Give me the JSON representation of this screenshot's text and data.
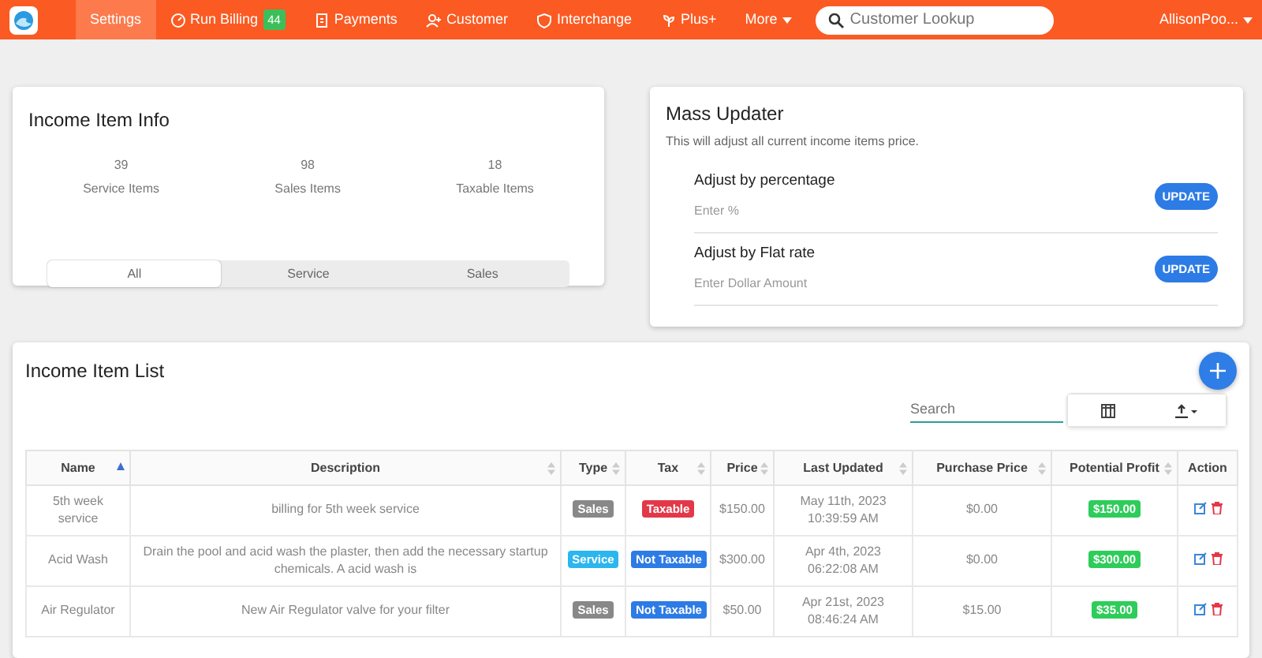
{
  "navbar": {
    "items": [
      {
        "label": "Settings",
        "selected": true
      },
      {
        "label": "Run Billing",
        "badge": "44",
        "selected": false
      },
      {
        "label": "Payments",
        "selected": false
      },
      {
        "label": "Customer",
        "selected": false
      },
      {
        "label": "Interchange",
        "selected": false
      },
      {
        "label": "Plus+",
        "selected": false
      },
      {
        "label": "More",
        "dropdown": true,
        "selected": false
      }
    ],
    "search": {
      "placeholder": "Customer Lookup"
    },
    "user": "AllisonPoo..."
  },
  "info": {
    "title": "Income Item Info",
    "stats": [
      {
        "value": "39",
        "label": "Service Items"
      },
      {
        "value": "98",
        "label": "Sales Items"
      },
      {
        "value": "18",
        "label": "Taxable Items"
      }
    ],
    "filters": [
      {
        "label": "All",
        "selected": true
      },
      {
        "label": "Service",
        "selected": false
      },
      {
        "label": "Sales",
        "selected": false
      }
    ]
  },
  "mass_updater": {
    "title": "Mass Updater",
    "subtitle": "This will adjust all current income items price.",
    "adjusters": [
      {
        "label": "Adjust by percentage",
        "placeholder": "Enter %",
        "button": "UPDATE"
      },
      {
        "label": "Adjust by Flat rate",
        "placeholder": "Enter Dollar Amount",
        "button": "UPDATE"
      }
    ]
  },
  "list": {
    "title": "Income Item List",
    "search": {
      "placeholder": "Search"
    },
    "columns": [
      {
        "label": "Name",
        "sorted": true
      },
      {
        "label": "Description",
        "sorted": false
      },
      {
        "label": "Type",
        "sorted": false
      },
      {
        "label": "Tax",
        "sorted": false
      },
      {
        "label": "Price",
        "sorted": false
      },
      {
        "label": "Last Updated",
        "sorted": false
      },
      {
        "label": "Purchase Price",
        "sorted": false
      },
      {
        "label": "Potential Profit",
        "sorted": false
      },
      {
        "label": "Action"
      }
    ],
    "rows": [
      {
        "name": "5th week service",
        "description": "billing for 5th week service",
        "type": "Sales",
        "color": "#888888",
        "taxable": true,
        "tax": "Taxable",
        "price": "$150.00",
        "last_updated": "May 11th, 2023 10:39:59 AM",
        "purchase_price": "$0.00",
        "profit": "$150.00"
      },
      {
        "name": "Acid Wash",
        "description": "Drain the pool and acid wash the plaster, then add the necessary startup chemicals. A acid wash is",
        "type": "Service",
        "color": "#2bb6ee",
        "taxable": false,
        "tax": "Not Taxable",
        "price": "$300.00",
        "last_updated": "Apr 4th, 2023 06:22:08 AM",
        "purchase_price": "$0.00",
        "profit": "$300.00"
      },
      {
        "name": "Air Regulator",
        "description": "New Air Regulator valve for your filter",
        "type": "Sales",
        "color": "#888888",
        "taxable": false,
        "tax": "Not Taxable",
        "price": "$50.00",
        "last_updated": "Apr 21st, 2023 08:46:24 AM",
        "purchase_price": "$15.00",
        "profit": "$35.00"
      }
    ]
  }
}
